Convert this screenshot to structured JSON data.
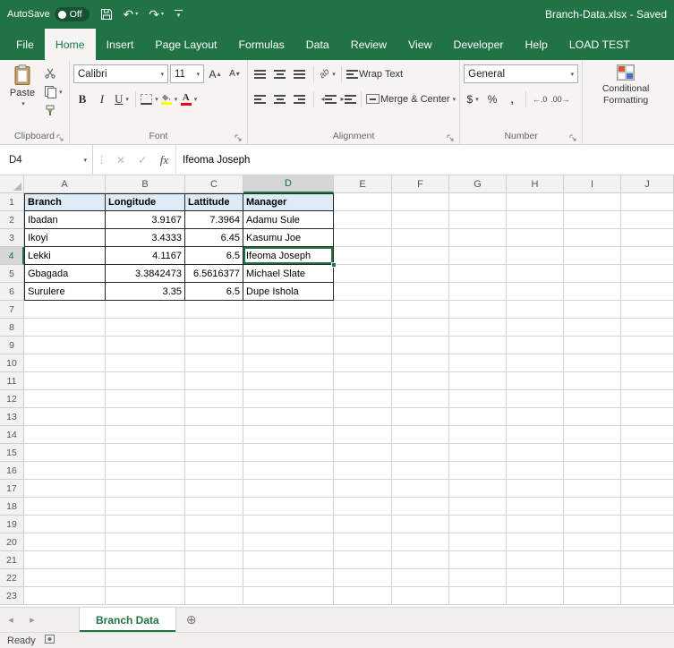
{
  "title_bar": {
    "autosave_label": "AutoSave",
    "autosave_state": "Off",
    "document_title": "Branch-Data.xlsx  -  Saved"
  },
  "ribbon": {
    "tabs": [
      "File",
      "Home",
      "Insert",
      "Page Layout",
      "Formulas",
      "Data",
      "Review",
      "View",
      "Developer",
      "Help",
      "LOAD TEST"
    ],
    "active_tab": "Home",
    "groups": {
      "clipboard": {
        "label": "Clipboard",
        "paste_label": "Paste"
      },
      "font": {
        "label": "Font",
        "font_name": "Calibri",
        "font_size": "11",
        "bold": "B",
        "italic": "I",
        "underline": "U"
      },
      "alignment": {
        "label": "Alignment",
        "wrap_text": "Wrap Text",
        "merge_center": "Merge & Center"
      },
      "number": {
        "label": "Number",
        "format": "General",
        "currency": "$",
        "percent": "%",
        "comma": ","
      },
      "styles": {
        "conditional_line1": "Conditional",
        "conditional_line2": "Formatting"
      }
    }
  },
  "formula_bar": {
    "name_box": "D4",
    "fx_label": "fx",
    "value": "Ifeoma Joseph"
  },
  "grid": {
    "columns": [
      "A",
      "B",
      "C",
      "D",
      "E",
      "F",
      "G",
      "H",
      "I",
      "J"
    ],
    "row_count": 23,
    "selected_cell": {
      "column": "D",
      "row": 4
    },
    "table": {
      "header_fill": "#DDEBF7",
      "rows": [
        [
          "Branch",
          "Longitude",
          "Lattitude",
          "Manager"
        ],
        [
          "Ibadan",
          "3.9167",
          "7.3964",
          "Adamu Sule"
        ],
        [
          "Ikoyi",
          "3.4333",
          "6.45",
          "Kasumu Joe"
        ],
        [
          "Lekki",
          "4.1167",
          "6.5",
          "Ifeoma Joseph"
        ],
        [
          "Gbagada",
          "3.3842473",
          "6.5616377",
          "Michael Slate"
        ],
        [
          "Surulere",
          "3.35",
          "6.5",
          "Dupe Ishola"
        ]
      ]
    }
  },
  "sheet_bar": {
    "tabs": [
      "Branch Data"
    ],
    "active_tab": "Branch Data"
  },
  "status_bar": {
    "status": "Ready"
  },
  "colors": {
    "brand_green": "#217346",
    "header_fill": "#DDEBF7",
    "fill_color_swatch": "#FFFF00",
    "font_color_swatch": "#FF0000"
  }
}
